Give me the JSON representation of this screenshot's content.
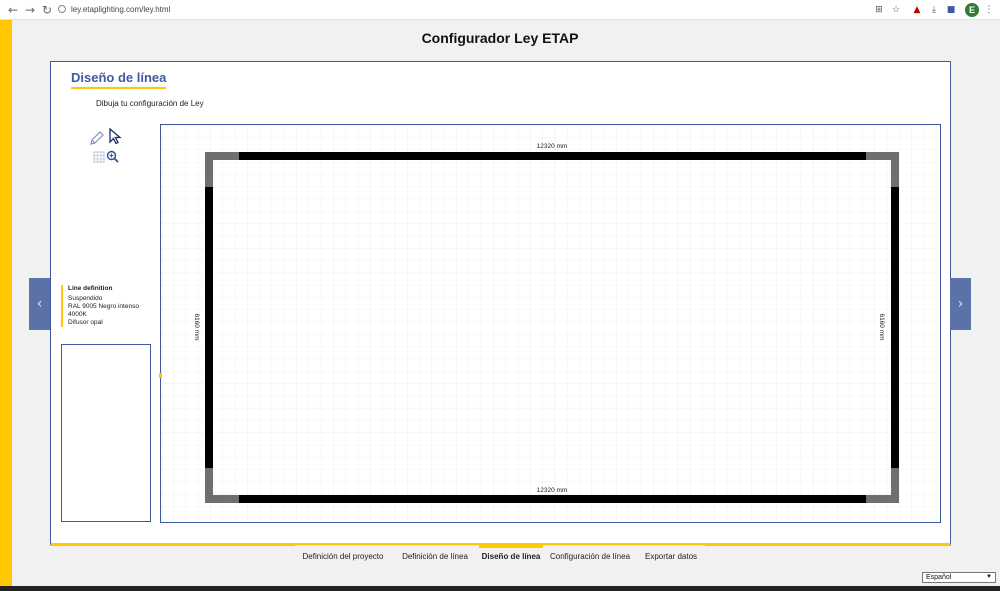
{
  "browser": {
    "url": "ley.etaplighting.com/ley.html",
    "back_icon": "arrow-left",
    "forward_icon": "arrow-right",
    "reload_icon": "reload",
    "profile_initial": "E"
  },
  "app": {
    "title": "Configurador Ley ETAP",
    "accent_color": "#ffc800",
    "brand_color": "#3f5a9e"
  },
  "section": {
    "title": "Diseño de línea",
    "subtitle": "Dibuja tu configuración de Ley"
  },
  "tools": [
    "pencil-icon",
    "cursor-icon",
    "grid-icon",
    "zoom-icon"
  ],
  "line_definition": {
    "title": "Line definition",
    "mounting": "Suspendido",
    "color": "RAL 9005 Negro intenso",
    "cct": "4000K",
    "diffuser": "Difusor opal"
  },
  "canvas": {
    "top_dimension": "12320 mm",
    "bottom_dimension": "12320 mm",
    "left_dimension": "6160 mm",
    "right_dimension": "6160 mm"
  },
  "steps": {
    "items": [
      {
        "label": "Definición del proyecto",
        "active": false
      },
      {
        "label": "Definición de línea",
        "active": false
      },
      {
        "label": "Diseño de línea",
        "active": true
      },
      {
        "label": "Configuración de línea",
        "active": false
      },
      {
        "label": "Exportar datos",
        "active": false
      }
    ]
  },
  "language": {
    "selected": "Español"
  }
}
